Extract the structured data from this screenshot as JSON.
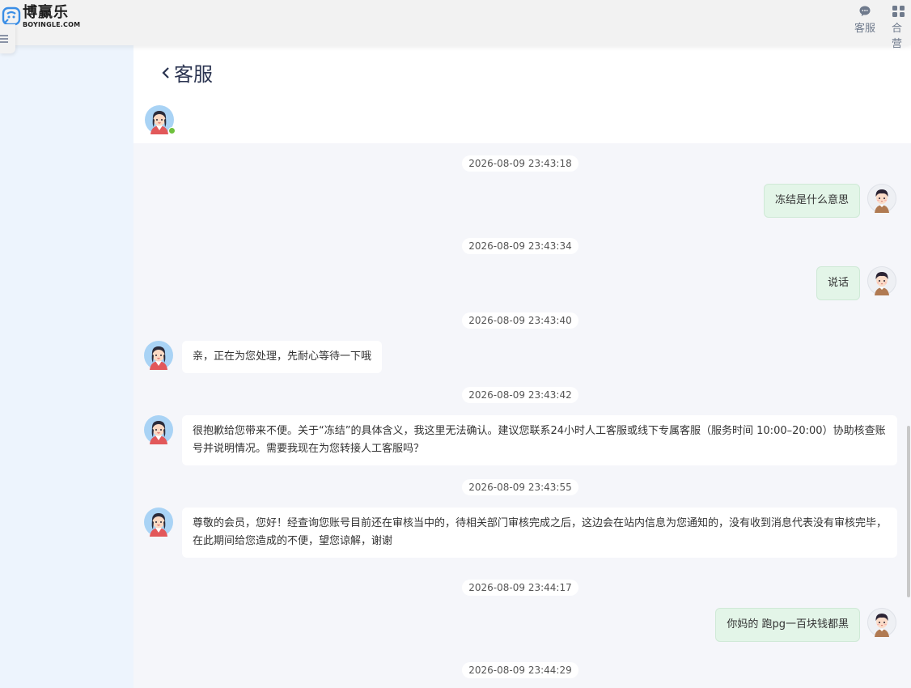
{
  "brand": {
    "name": "博赢乐",
    "domain": "BOYINGLE.COM",
    "accent": "#3a8ee6"
  },
  "nav": [
    {
      "label": "客服",
      "icon": "chat-bubble-icon"
    },
    {
      "label": "合营",
      "icon": "partner-icon"
    }
  ],
  "chat": {
    "title": "客服",
    "agent_status": "online",
    "colors": {
      "user_bubble": "#e3f5e8",
      "agent_bubble": "#ffffff",
      "online": "#6ec13c"
    }
  },
  "messages": [
    {
      "time": "2026-08-09 23:43:18",
      "side": "user",
      "text": "冻结是什么意思"
    },
    {
      "time": "2026-08-09 23:43:34",
      "side": "user",
      "text": "说话"
    },
    {
      "time": "2026-08-09 23:43:40",
      "side": "agent",
      "text": "亲，正在为您处理，先耐心等待一下哦"
    },
    {
      "time": "2026-08-09 23:43:42",
      "side": "agent",
      "text": "很抱歉给您带来不便。关于“冻结”的具体含义，我这里无法确认。建议您联系24小时人工客服或线下专属客服（服务时间 10:00–20:00）协助核查账号并说明情况。需要我现在为您转接人工客服吗？"
    },
    {
      "time": "2026-08-09 23:43:55",
      "side": "agent",
      "text": "尊敬的会员，您好！经查询您账号目前还在审核当中的，待相关部门审核完成之后，这边会在站内信息为您通知的，没有收到消息代表没有审核完毕，在此期间给您造成的不便，望您谅解，谢谢"
    },
    {
      "time": "2026-08-09 23:44:17",
      "side": "user",
      "text": "你妈的 跑pg一百块钱都黑"
    },
    {
      "time": "2026-08-09 23:44:29",
      "side": "user",
      "text": ""
    }
  ]
}
